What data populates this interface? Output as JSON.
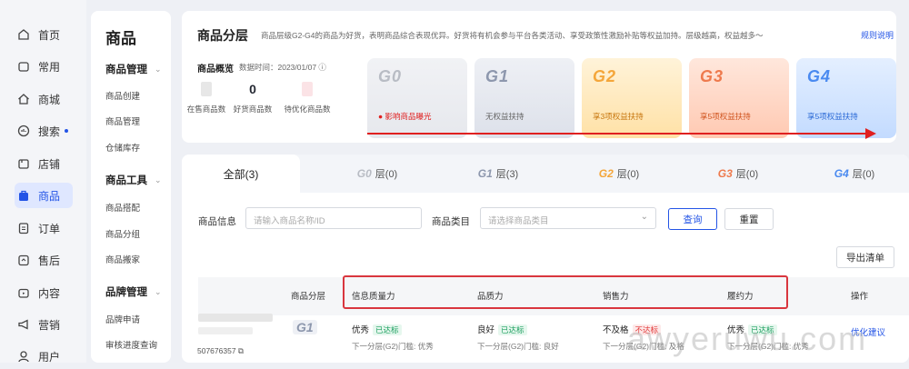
{
  "leftnav": {
    "items": [
      {
        "label": "首页",
        "icon": "home-icon"
      },
      {
        "label": "常用",
        "icon": "folder-icon"
      },
      {
        "label": "商城",
        "icon": "house-icon"
      },
      {
        "label": "搜索",
        "icon": "search-chart-icon"
      },
      {
        "label": "店铺",
        "icon": "store-icon"
      },
      {
        "label": "商品",
        "icon": "bag-icon"
      },
      {
        "label": "订单",
        "icon": "order-icon"
      },
      {
        "label": "售后",
        "icon": "aftersale-icon"
      },
      {
        "label": "内容",
        "icon": "tv-icon"
      },
      {
        "label": "营销",
        "icon": "megaphone-icon"
      },
      {
        "label": "用户",
        "icon": "user-icon"
      }
    ]
  },
  "subnav": {
    "title": "商品",
    "groups": [
      {
        "label": "商品管理",
        "items": [
          "商品创建",
          "商品管理",
          "仓储库存"
        ]
      },
      {
        "label": "商品工具",
        "items": [
          "商品搭配",
          "商品分组",
          "商品搬家"
        ]
      },
      {
        "label": "品牌管理",
        "items": [
          "品牌申请",
          "审核进度查询"
        ]
      }
    ]
  },
  "top": {
    "title": "商品分层",
    "desc": "商品层级G2-G4的商品为好货，表明商品综合表现优异。好货将有机会参与平台各类活动、享受政策性激励补贴等权益加持。层级越高，权益越多～",
    "rule_link": "规则说明",
    "overview_title": "商品概览",
    "overview_time": "数据时间：2023/01/07 ⓘ",
    "stats": [
      {
        "value": "",
        "label": "在售商品数"
      },
      {
        "value": "0",
        "label": "好货商品数"
      },
      {
        "value": "",
        "label": "待优化商品数"
      }
    ],
    "grades": [
      {
        "name": "G0",
        "sub": "● 影响商品曝光",
        "color": "#b8bcc4",
        "sub_color": "#e02020"
      },
      {
        "name": "G1",
        "sub": "无权益扶持",
        "color": "#8d97ad",
        "sub_color": "#666666"
      },
      {
        "name": "G2",
        "sub": "享3项权益扶持",
        "color": "#f4a63a",
        "sub_color": "#c77710"
      },
      {
        "name": "G3",
        "sub": "享5项权益扶持",
        "color": "#ee7a4d",
        "sub_color": "#d05520"
      },
      {
        "name": "G4",
        "sub": "享5项权益扶持",
        "color": "#4a8af0",
        "sub_color": "#2b6ad6"
      }
    ]
  },
  "tabs": {
    "all": "全部(3)",
    "items": [
      {
        "g": "G0",
        "label": "层(0)"
      },
      {
        "g": "G1",
        "label": "层(3)"
      },
      {
        "g": "G2",
        "label": "层(0)"
      },
      {
        "g": "G3",
        "label": "层(0)"
      },
      {
        "g": "G4",
        "label": "层(0)"
      }
    ]
  },
  "filters": {
    "info_label": "商品信息",
    "info_placeholder": "请输入商品名称/ID",
    "cat_label": "商品类目",
    "cat_placeholder": "请选择商品类目",
    "query": "查询",
    "reset": "重置",
    "export": "导出清单"
  },
  "table": {
    "headers": [
      "商品分层",
      "信息质量力",
      "品质力",
      "销售力",
      "履约力",
      "操作"
    ],
    "row": {
      "id": "507676357",
      "grade": "G1",
      "info": {
        "value": "优秀",
        "tag": "已达标",
        "sub": "下一分层(G2)门槛: 优秀"
      },
      "quality": {
        "value": "良好",
        "tag": "已达标",
        "sub": "下一分层(G2)门槛: 良好"
      },
      "sales": {
        "value": "不及格",
        "tag": "不达标",
        "sub": "下一分层(G2)门槛: 及格"
      },
      "fulfill": {
        "value": "优秀",
        "tag": "已达标",
        "sub": "下一分层(G2)门槛: 优秀"
      },
      "action": "优化建议"
    }
  },
  "watermark": "awyeruwu.com"
}
